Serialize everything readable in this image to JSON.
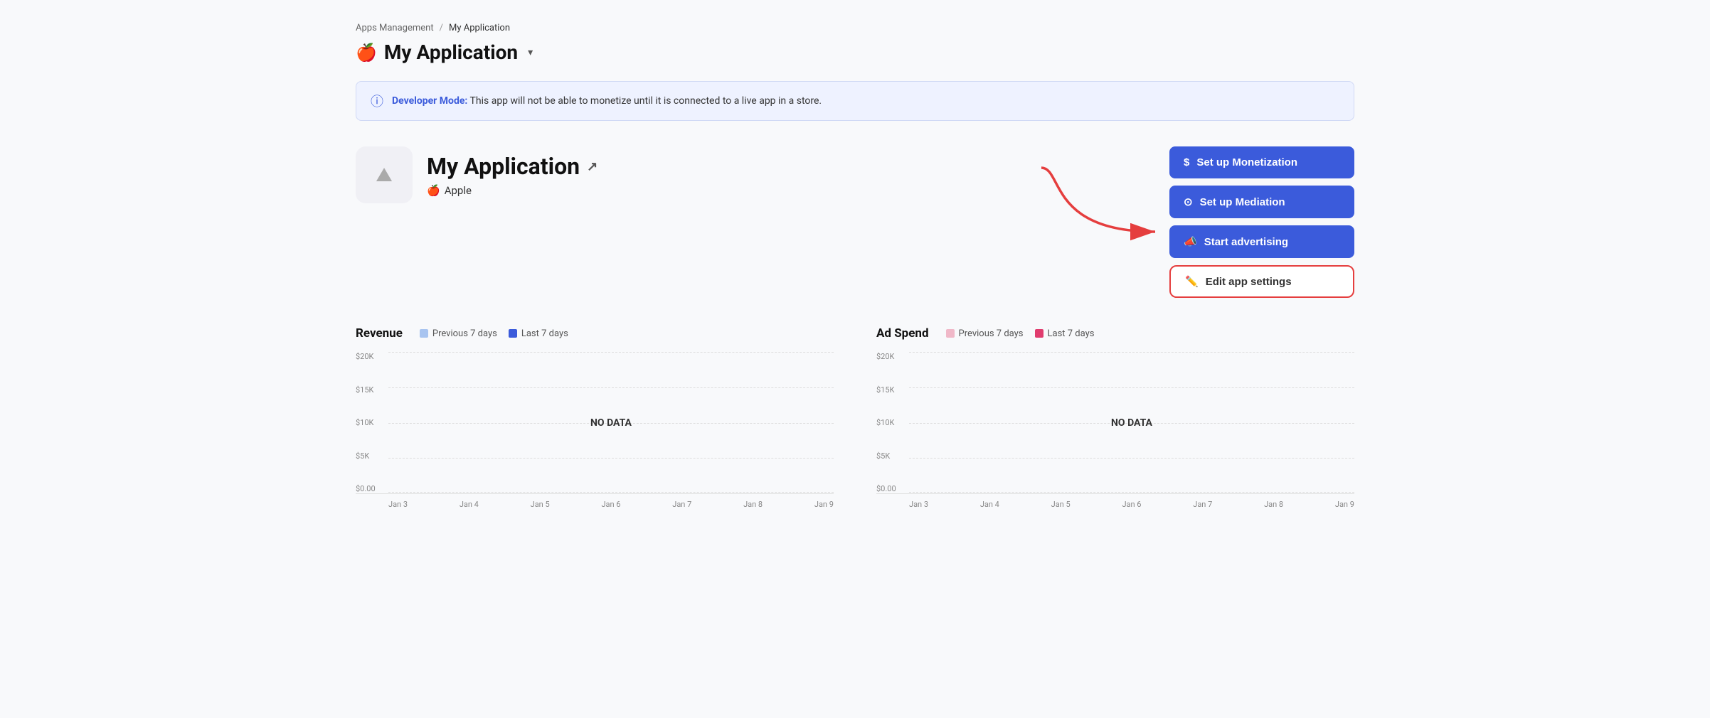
{
  "breadcrumb": {
    "parent": "Apps Management",
    "separator": "/",
    "current": "My Application"
  },
  "page_title": {
    "apple_icon": "🍎",
    "title": "My Application",
    "dropdown_arrow": "▾"
  },
  "banner": {
    "label": "Developer Mode:",
    "message": " This app will not be able to monetize until it is connected to a live app in a store."
  },
  "app": {
    "name": "My Application",
    "platform": "Apple",
    "apple_icon": "🍎"
  },
  "buttons": {
    "setup_monetization": "Set up Monetization",
    "setup_mediation": "Set up Mediation",
    "start_advertising": "Start advertising",
    "edit_app_settings": "Edit app settings"
  },
  "revenue_chart": {
    "title": "Revenue",
    "legend": {
      "previous": "Previous 7 days",
      "last": "Last 7 days"
    },
    "y_labels": [
      "$20K",
      "$15K",
      "$10K",
      "$5K",
      "$0.00"
    ],
    "x_labels": [
      "Jan 3",
      "Jan 4",
      "Jan 5",
      "Jan 6",
      "Jan 7",
      "Jan 8",
      "Jan 9"
    ],
    "no_data": "NO DATA"
  },
  "adspend_chart": {
    "title": "Ad Spend",
    "legend": {
      "previous": "Previous 7 days",
      "last": "Last 7 days"
    },
    "y_labels": [
      "$20K",
      "$15K",
      "$10K",
      "$5K",
      "$0.00"
    ],
    "x_labels": [
      "Jan 3",
      "Jan 4",
      "Jan 5",
      "Jan 6",
      "Jan 7",
      "Jan 8",
      "Jan 9"
    ],
    "no_data": "NO DATA"
  }
}
